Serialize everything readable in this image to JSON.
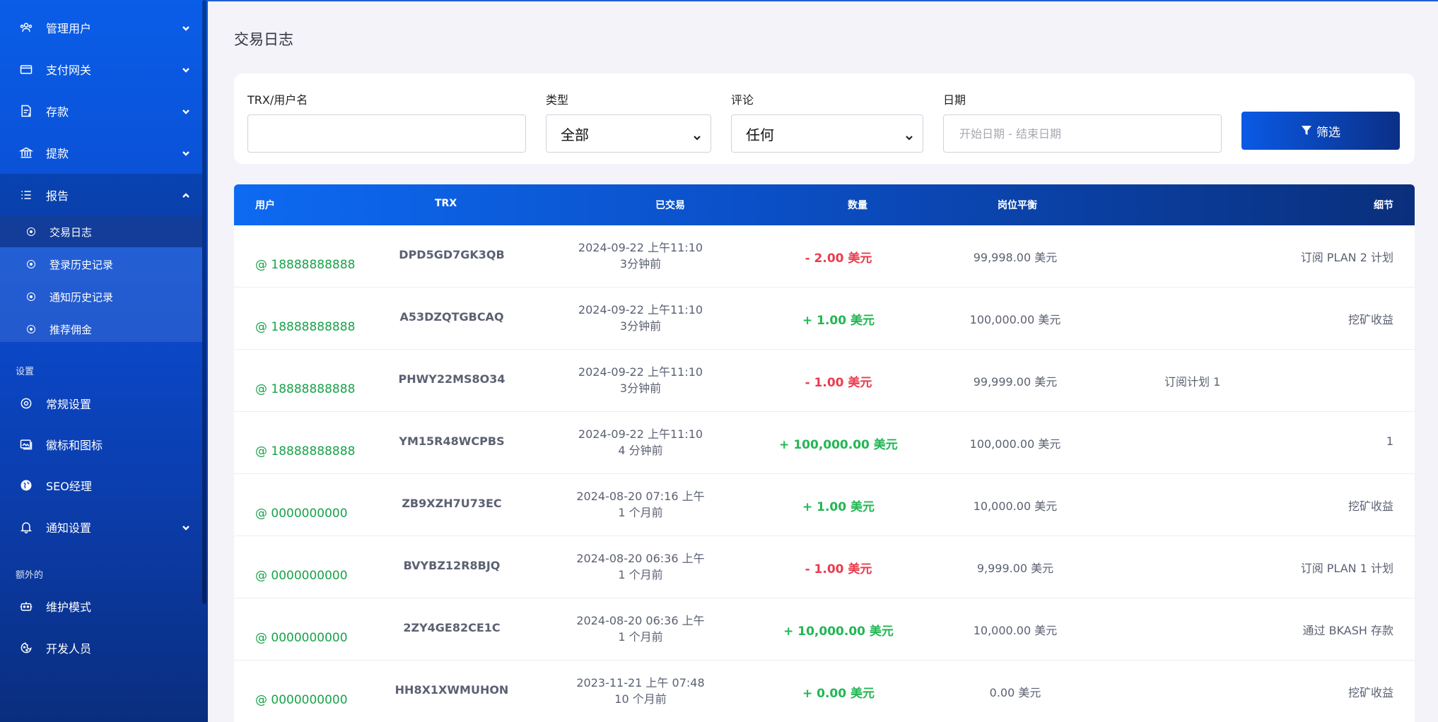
{
  "sidebar": {
    "items": [
      {
        "label": "管理用户",
        "icon": "users-icon",
        "has_chevron": true
      },
      {
        "label": "支付网关",
        "icon": "credit-card-icon",
        "has_chevron": true
      },
      {
        "label": "存款",
        "icon": "deposit-icon",
        "has_chevron": true
      },
      {
        "label": "提款",
        "icon": "bank-icon",
        "has_chevron": true
      },
      {
        "label": "报告",
        "icon": "list-icon",
        "has_chevron": true,
        "expanded": true
      }
    ],
    "report_sub": [
      {
        "label": "交易日志",
        "active": true
      },
      {
        "label": "登录历史记录"
      },
      {
        "label": "通知历史记录"
      },
      {
        "label": "推荐佣金"
      }
    ],
    "section_settings": "设置",
    "settings_items": [
      {
        "label": "常规设置",
        "icon": "settings-icon"
      },
      {
        "label": "徽标和图标",
        "icon": "image-icon"
      },
      {
        "label": "SEO经理",
        "icon": "globe-icon"
      },
      {
        "label": "通知设置",
        "icon": "bell-icon",
        "has_chevron": true
      }
    ],
    "section_extra": "额外的",
    "extra_items": [
      {
        "label": "维护模式",
        "icon": "robot-icon"
      },
      {
        "label": "开发人员",
        "icon": "cookie-icon"
      }
    ]
  },
  "page_title": "交易日志",
  "filters": {
    "trx_label": "TRX/用户名",
    "trx_value": "",
    "type_label": "类型",
    "type_value": "全部",
    "remark_label": "评论",
    "remark_value": "任何",
    "date_label": "日期",
    "date_placeholder": "开始日期 - 结束日期",
    "button_label": "筛选"
  },
  "table": {
    "headers": {
      "user": "用户",
      "trx": "TRX",
      "transacted": "已交易",
      "amount": "数量",
      "post_balance": "岗位平衡",
      "detail": "细节"
    },
    "rows": [
      {
        "user": "@ 18888888888",
        "trx": "DPD5GD7GK3QB",
        "date": "2024-09-22 上午11:10",
        "ago": "3分钟前",
        "amount": "- 2.00 美元",
        "sign": "neg",
        "balance": "99,998.00 美元",
        "detail": "订阅 PLAN 2 计划",
        "detail_align": "right"
      },
      {
        "user": "@ 18888888888",
        "trx": "A53DZQTGBCAQ",
        "date": "2024-09-22 上午11:10",
        "ago": "3分钟前",
        "amount": "+ 1.00 美元",
        "sign": "pos",
        "balance": "100,000.00 美元",
        "detail": "挖矿收益",
        "detail_align": "right"
      },
      {
        "user": "@ 18888888888",
        "trx": "PHWY22MS8O34",
        "date": "2024-09-22 上午11:10",
        "ago": "3分钟前",
        "amount": "- 1.00 美元",
        "sign": "neg",
        "balance": "99,999.00 美元",
        "detail": "订阅计划 1",
        "detail_align": "mid"
      },
      {
        "user": "@ 18888888888",
        "trx": "YM15R48WCPBS",
        "date": "2024-09-22 上午11:10",
        "ago": "4 分钟前",
        "amount": "+ 100,000.00 美元",
        "sign": "pos",
        "balance": "100,000.00 美元",
        "detail": "1",
        "detail_align": "right"
      },
      {
        "user": "@ 0000000000",
        "trx": "ZB9XZH7U73EC",
        "date": "2024-08-20 07:16 上午",
        "ago": "1 个月前",
        "amount": "+ 1.00 美元",
        "sign": "pos",
        "balance": "10,000.00 美元",
        "detail": "挖矿收益",
        "detail_align": "right"
      },
      {
        "user": "@ 0000000000",
        "trx": "BVYBZ12R8BJQ",
        "date": "2024-08-20 06:36 上午",
        "ago": "1 个月前",
        "amount": "- 1.00 美元",
        "sign": "neg",
        "balance": "9,999.00 美元",
        "detail": "订阅 PLAN 1 计划",
        "detail_align": "right"
      },
      {
        "user": "@ 0000000000",
        "trx": "2ZY4GE82CE1C",
        "date": "2024-08-20 06:36 上午",
        "ago": "1 个月前",
        "amount": "+ 10,000.00 美元",
        "sign": "pos",
        "balance": "10,000.00 美元",
        "detail": "通过 BKASH 存款",
        "detail_align": "right"
      },
      {
        "user": "@ 0000000000",
        "trx": "HH8X1XWMUHON",
        "date": "2023-11-21 上午 07:48",
        "ago": "10 个月前",
        "amount": "+ 0.00 美元",
        "sign": "pos",
        "balance": "0.00 美元",
        "detail": "挖矿收益",
        "detail_align": "right"
      }
    ]
  }
}
